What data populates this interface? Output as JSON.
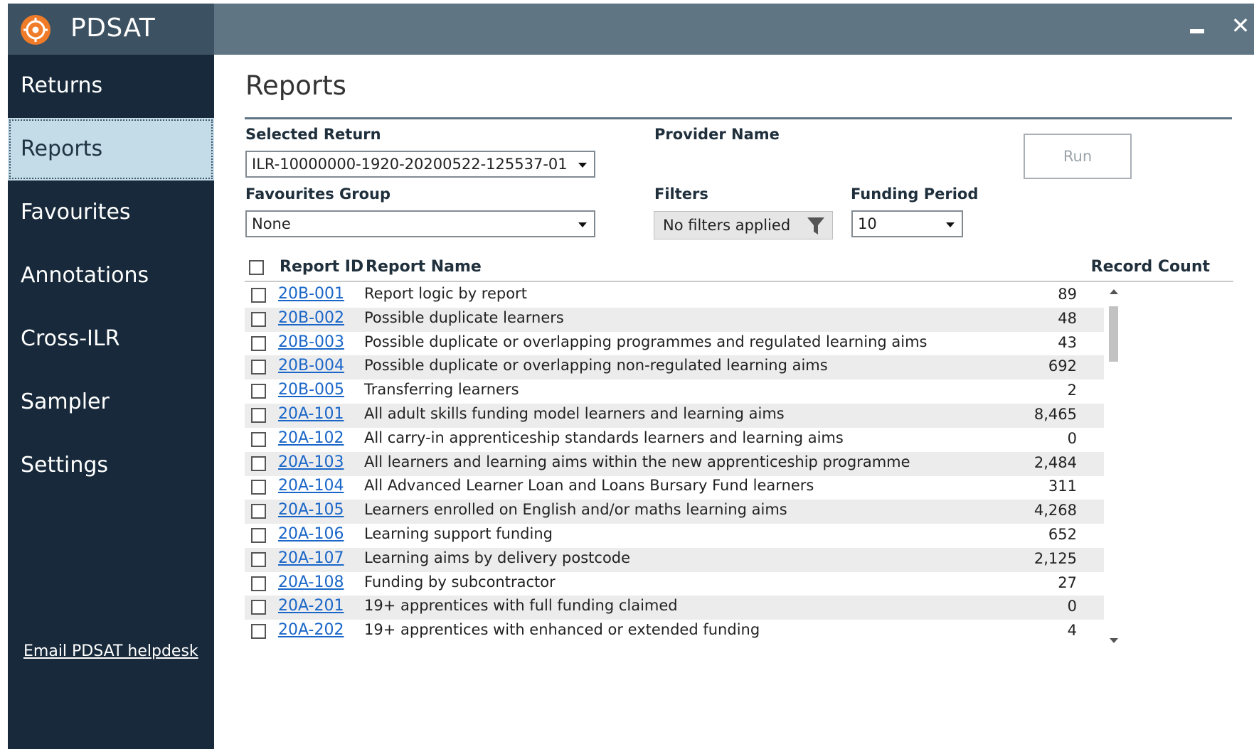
{
  "app": {
    "title": "PDSAT",
    "logo_icon": "pdsat-logo-icon",
    "accent": "#f07c2a"
  },
  "sidebar": {
    "items": [
      {
        "label": "Returns",
        "active": false
      },
      {
        "label": "Reports",
        "active": true
      },
      {
        "label": "Favourites",
        "active": false
      },
      {
        "label": "Annotations",
        "active": false
      },
      {
        "label": "Cross-ILR",
        "active": false
      },
      {
        "label": "Sampler",
        "active": false
      },
      {
        "label": "Settings",
        "active": false
      }
    ],
    "helpdesk_link": "Email PDSAT helpdesk"
  },
  "main": {
    "title": "Reports",
    "selected_return_label": "Selected Return",
    "selected_return_value": "ILR-10000000-1920-20200522-125537-01",
    "provider_name_label": "Provider Name",
    "favourites_group_label": "Favourites Group",
    "favourites_group_value": "None",
    "filters_label": "Filters",
    "filters_value": "No filters applied",
    "funding_period_label": "Funding Period",
    "funding_period_value": "10",
    "run_label": "Run"
  },
  "table": {
    "columns": {
      "report_id": "Report ID",
      "report_name": "Report Name",
      "record_count": "Record Count"
    },
    "rows": [
      {
        "id": "20B-001",
        "name": "Report logic by report",
        "count": "89"
      },
      {
        "id": "20B-002",
        "name": "Possible duplicate learners",
        "count": "48"
      },
      {
        "id": "20B-003",
        "name": "Possible duplicate or overlapping programmes and regulated learning aims",
        "count": "43"
      },
      {
        "id": "20B-004",
        "name": "Possible duplicate or overlapping non-regulated learning aims",
        "count": "692"
      },
      {
        "id": "20B-005",
        "name": "Transferring learners",
        "count": "2"
      },
      {
        "id": "20A-101",
        "name": "All adult skills funding model learners and learning aims",
        "count": "8,465"
      },
      {
        "id": "20A-102",
        "name": "All carry-in apprenticeship standards learners and learning aims",
        "count": "0"
      },
      {
        "id": "20A-103",
        "name": "All learners and learning aims within the new apprenticeship programme",
        "count": "2,484"
      },
      {
        "id": "20A-104",
        "name": "All Advanced Learner Loan and Loans Bursary Fund learners",
        "count": "311"
      },
      {
        "id": "20A-105",
        "name": "Learners enrolled on English and/or maths learning aims",
        "count": "4,268"
      },
      {
        "id": "20A-106",
        "name": "Learning support funding",
        "count": "652"
      },
      {
        "id": "20A-107",
        "name": "Learning aims by delivery postcode",
        "count": "2,125"
      },
      {
        "id": "20A-108",
        "name": "Funding by subcontractor",
        "count": "27"
      },
      {
        "id": "20A-201",
        "name": "19+ apprentices with full funding claimed",
        "count": "0"
      },
      {
        "id": "20A-202",
        "name": "19+ apprentices with enhanced or extended funding",
        "count": "4"
      }
    ]
  }
}
